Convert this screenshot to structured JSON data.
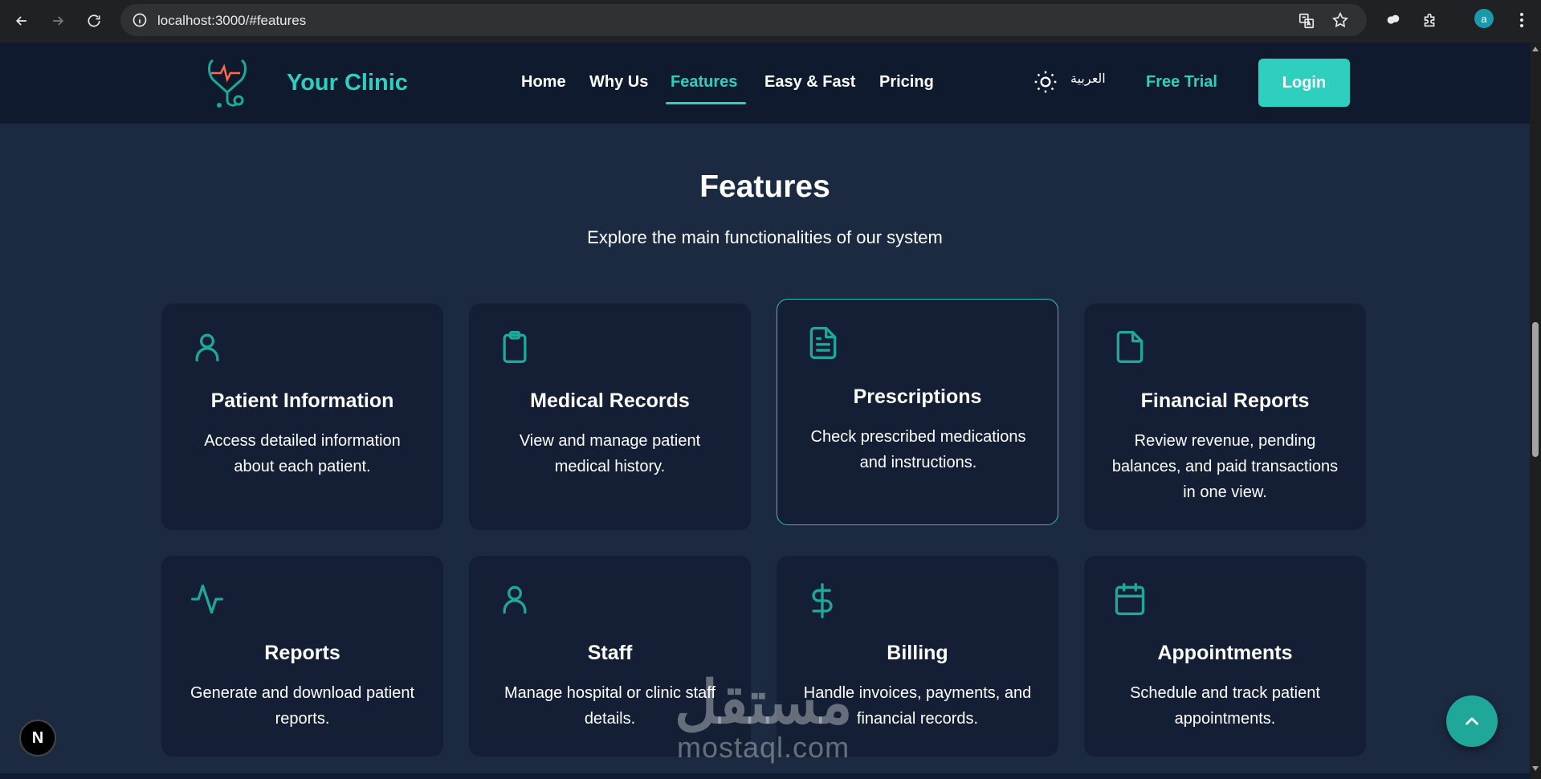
{
  "browser": {
    "url": "localhost:3000/#features",
    "profile_initial": "a"
  },
  "nav": {
    "brand": "Your Clinic",
    "links": [
      "Home",
      "Why Us",
      "Features",
      "Easy & Fast",
      "Pricing"
    ],
    "active_link": "Features",
    "language": "العربية",
    "free_trial": "Free Trial",
    "login": "Login"
  },
  "section": {
    "title": "Features",
    "subtitle": "Explore the main functionalities of our system"
  },
  "cards": [
    {
      "icon": "user-icon",
      "title": "Patient Information",
      "desc": "Access detailed information about each patient."
    },
    {
      "icon": "clipboard-icon",
      "title": "Medical Records",
      "desc": "View and manage patient medical history."
    },
    {
      "icon": "file-text-icon",
      "title": "Prescriptions",
      "desc": "Check prescribed medications and instructions."
    },
    {
      "icon": "file-icon",
      "title": "Financial Reports",
      "desc": "Review revenue, pending balances, and paid transactions in one view."
    },
    {
      "icon": "activity-icon",
      "title": "Reports",
      "desc": "Generate and download patient reports."
    },
    {
      "icon": "user-icon",
      "title": "Staff",
      "desc": "Manage hospital or clinic staff details."
    },
    {
      "icon": "dollar-sign-icon",
      "title": "Billing",
      "desc": "Handle invoices, payments, and financial records."
    },
    {
      "icon": "calendar-icon",
      "title": "Appointments",
      "desc": "Schedule and track patient appointments."
    }
  ],
  "overlay": {
    "next_badge": "N",
    "watermark_ar": "مستقل",
    "watermark_en": "mostaql.com"
  },
  "colors": {
    "accent": "#2fcfbf",
    "background": "#1b2a40",
    "navbar": "#0f1a2e",
    "card": "#141f35",
    "icon": "#1fa89a"
  }
}
